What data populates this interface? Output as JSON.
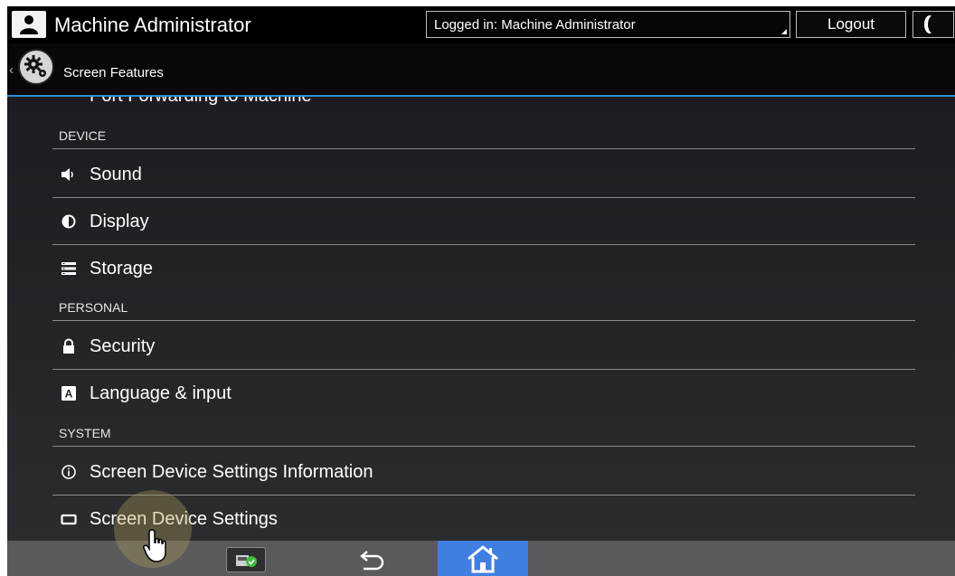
{
  "header": {
    "user_name": "Machine Administrator",
    "login_status": "Logged in: Machine Administrator",
    "logout_label": "Logout",
    "user_icon": "person-icon",
    "night_mode_icon": "moon-icon"
  },
  "appbar": {
    "title": "Screen Features",
    "back_icon": "chevron-left-icon",
    "app_icon": "gear-icon",
    "accent_color": "#2a8fd0"
  },
  "settings": {
    "partial_item": {
      "label": "Port Forwarding to Machine",
      "icon": "port-icon"
    },
    "sections": [
      {
        "header": "DEVICE",
        "items": [
          {
            "label": "Sound",
            "icon": "speaker-icon"
          },
          {
            "label": "Display",
            "icon": "brightness-icon"
          },
          {
            "label": "Storage",
            "icon": "storage-icon"
          }
        ]
      },
      {
        "header": "PERSONAL",
        "items": [
          {
            "label": "Security",
            "icon": "lock-icon"
          },
          {
            "label": "Language & input",
            "icon": "keyboard-a-icon"
          }
        ]
      },
      {
        "header": "SYSTEM",
        "items": [
          {
            "label": "Screen Device Settings Information",
            "icon": "info-icon"
          },
          {
            "label": "Screen Device Settings",
            "icon": "screen-icon"
          }
        ]
      }
    ]
  },
  "bottombar": {
    "status_icon": "device-status-icon",
    "back_icon": "back-arrow-icon",
    "home_icon": "home-icon",
    "home_color": "#3f7fe0"
  }
}
